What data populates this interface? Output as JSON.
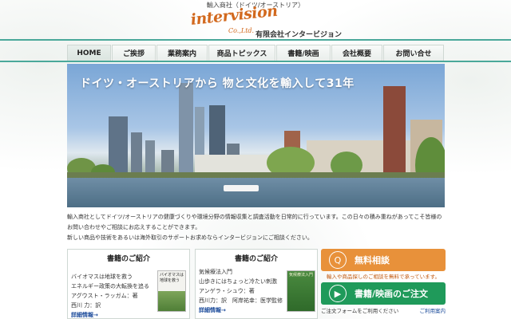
{
  "header": {
    "tagline": "輸入商社（ドイツ/オーストリア）",
    "logo_text": "intervision",
    "logo_co": "Co.,Ltd.",
    "company_name": "有限会社インタービジョン"
  },
  "nav": {
    "items": [
      {
        "label": "HOME",
        "active": true
      },
      {
        "label": "ご挨拶"
      },
      {
        "label": "業務案内"
      },
      {
        "label": "商品トピックス"
      },
      {
        "label": "書籍/映画"
      },
      {
        "label": "会社概要"
      },
      {
        "label": "お問い合せ"
      }
    ]
  },
  "hero": {
    "title": "ドイツ・オーストリアから 物と文化を輸入して31年"
  },
  "intro": {
    "line1": "輸入商社としてドイツ/オーストリアの健康づくりや環境分野の情報収集と調査活動を日常的に行っています。この日々の積み重ねがあってこそ皆様の",
    "line2": "お問い合わせやご相談にお応えすることができます。",
    "line3": "新しい商品や技術をあるいは海外取引のサポートお求めならインタービジョンにご相談ください。"
  },
  "books": [
    {
      "heading": "書籍のご紹介",
      "lines": [
        "バイオマスは地球を救う",
        "エネルギー政策の大転換を追る",
        "アグウスト・ラッガム：著",
        "西川 力：訳"
      ],
      "more": "詳細情報→",
      "cover_title": "バイオマスは地球を救う"
    },
    {
      "heading": "書籍のご紹介",
      "lines": [
        "気候療法入門",
        "山歩きにはちょっと冷たい刺激",
        "アンゲラ・シュウ：著",
        "西川力：訳　阿岸祐幸：医学監修"
      ],
      "more": "詳細情報→",
      "cover_title": "気候療法入門"
    }
  ],
  "side": {
    "consult_label": "無料相談",
    "consult_sub": "輸入や商品探しのご相談を無料で承っています。",
    "order_label": "書籍/映画のご注文",
    "order_sub": "ご注文フォームをご利用ください",
    "order_link": "ご利用案内"
  },
  "colors": {
    "teal": "#4aa89a",
    "orange": "#e8913a",
    "green": "#1f9a5a",
    "logo": "#d2691e"
  }
}
